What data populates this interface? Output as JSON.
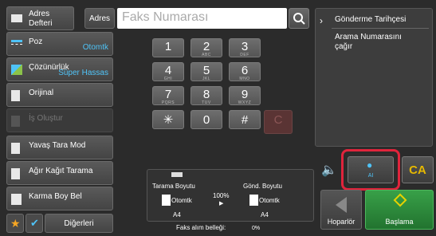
{
  "left": {
    "address_book": "Adres\nDefteri",
    "exposure_label": "Poz",
    "exposure_value": "Otomtk",
    "resolution_label": "Çözünürlük",
    "resolution_value": "Süper Hassas",
    "original_label": "Orijinal",
    "job_build_label": "İş Oluştur",
    "slow_scan_label": "Yavaş Tara Mod",
    "thick_paper_label": "Ağır Kağıt Tarama",
    "mixed_size_label": "Karma Boy Bel",
    "others_label": "Diğerleri"
  },
  "top": {
    "address_label": "Adres",
    "fax_placeholder": "Faks Numarası"
  },
  "keypad": {
    "keys": [
      {
        "n": "1",
        "s": ""
      },
      {
        "n": "2",
        "s": "ABC"
      },
      {
        "n": "3",
        "s": "DEF"
      },
      {
        "n": "4",
        "s": "GHI"
      },
      {
        "n": "5",
        "s": "JKL"
      },
      {
        "n": "6",
        "s": "MNO"
      },
      {
        "n": "7",
        "s": "PQRS"
      },
      {
        "n": "8",
        "s": "TUV"
      },
      {
        "n": "9",
        "s": "WXYZ"
      },
      {
        "n": "✳",
        "s": ""
      },
      {
        "n": "0",
        "s": ""
      },
      {
        "n": "#",
        "s": ""
      },
      {
        "n": "C",
        "s": ""
      }
    ]
  },
  "right": {
    "history": "Gönderme Tarihçesi",
    "call_program": "Arama Numarasını\nçağır"
  },
  "controls": {
    "ai_label": "AI",
    "ca_label": "CA",
    "speaker_label": "Hoparlör",
    "start_label": "Başlama"
  },
  "info": {
    "scan_size_label": "Tarama Boyutu",
    "send_size_label": "Gönd. Boyutu",
    "scan_auto": "Otomtk",
    "send_auto": "Otomtk",
    "ratio": "100%",
    "scan_paper": "A4",
    "send_paper": "A4",
    "fax_memory_label": "Faks alım belleği:",
    "fax_memory_value": "0%"
  },
  "colors": {
    "highlight": "#e0243c",
    "accent_blue": "#4fc3f7",
    "start_green": "#2d8a3c"
  }
}
